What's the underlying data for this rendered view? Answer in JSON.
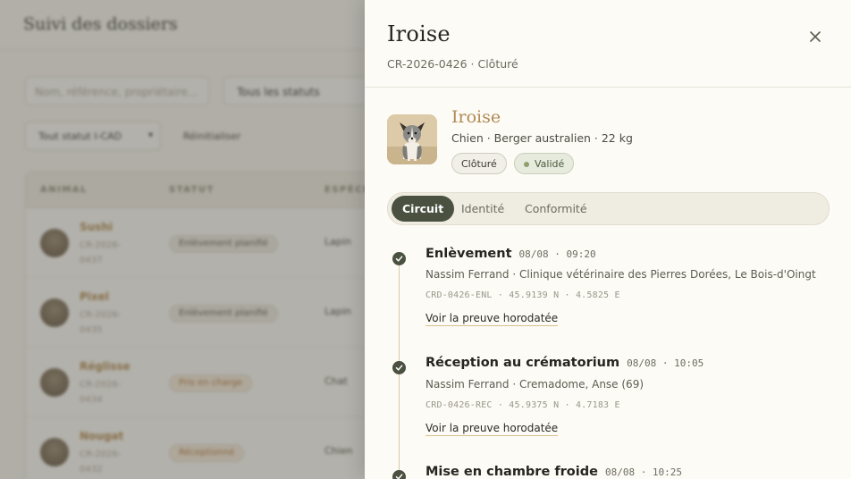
{
  "background": {
    "title": "Suivi des dossiers",
    "search_placeholder": "Nom, référence, propriétaire...",
    "status_filter": "Tous les statuts",
    "icad_filter": "Tout statut I-CAD",
    "reset_label": "Réinitialiser",
    "columns": [
      "ANIMAL",
      "STATUT",
      "ESPÈCE"
    ],
    "rows": [
      {
        "name": "Sushi",
        "ref": "CR-2026-0437",
        "status": "Enlèvement planifié",
        "species": "Lapin"
      },
      {
        "name": "Pixel",
        "ref": "CR-2026-0435",
        "status": "Enlèvement planifié",
        "species": "Lapin"
      },
      {
        "name": "Réglisse",
        "ref": "CR-2026-0434",
        "status": "Pris en charge",
        "species": "Chat"
      },
      {
        "name": "Nougat",
        "ref": "CR-2026-0432",
        "status": "Réceptionné",
        "species": "Chien"
      }
    ]
  },
  "drawer": {
    "title": "Iroise",
    "subtitle": "CR-2026-0426 · Clôturé",
    "close_icon": "close-icon",
    "pet": {
      "name": "Iroise",
      "meta": "Chien · Berger australien · 22 kg",
      "badges": {
        "closed": "Clôturé",
        "valid": "Validé"
      },
      "valid_color": "#8ea06e"
    },
    "tabs": [
      "Circuit",
      "Identité",
      "Conformité"
    ],
    "active_tab": "Circuit",
    "timeline": [
      {
        "title": "Enlèvement",
        "time": "08/08 · 09:20",
        "desc": "Nassim Ferrand · Clinique vétérinaire des Pierres Dorées, Le Bois-d'Oingt",
        "code": "CRD-0426-ENL · 45.9139 N · 4.5825 E",
        "link": "Voir la preuve horodatée"
      },
      {
        "title": "Réception au crématorium",
        "time": "08/08 · 10:05",
        "desc": "Nassim Ferrand · Cremadome, Anse (69)",
        "code": "CRD-0426-REC · 45.9375 N · 4.7183 E",
        "link": "Voir la preuve horodatée"
      },
      {
        "title": "Mise en chambre froide",
        "time": "08/08 · 10:25"
      }
    ]
  },
  "colors": {
    "accent_dark": "#4a5140",
    "accent_gold": "#b08a55",
    "overlay": "rgba(78,76,68,0.42)"
  }
}
